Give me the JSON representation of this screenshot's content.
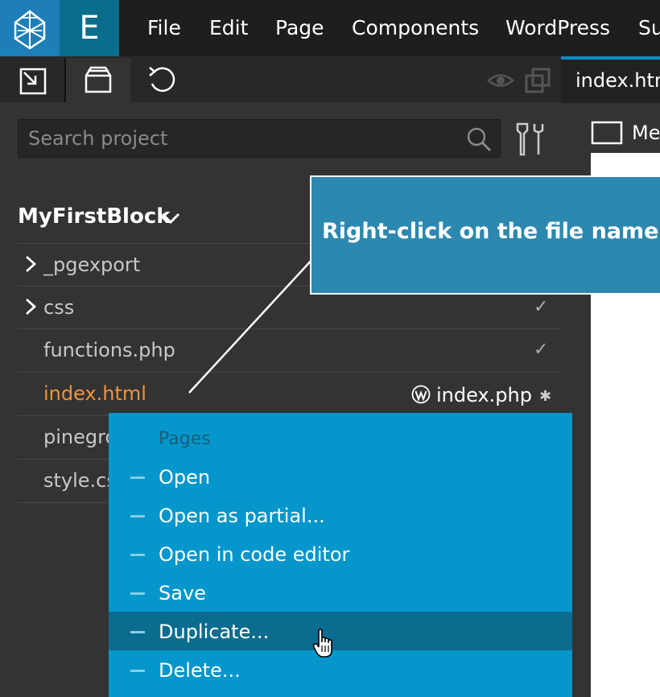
{
  "menubar": {
    "items": [
      "File",
      "Edit",
      "Page",
      "Components",
      "WordPress",
      "Su"
    ],
    "editor_letter": "E"
  },
  "search": {
    "placeholder": "Search project"
  },
  "project": {
    "name": "MyFirstBlock"
  },
  "files": [
    {
      "name": "_pgexport",
      "folder": true,
      "checked": false
    },
    {
      "name": "css",
      "folder": true,
      "checked": true
    },
    {
      "name": "functions.php",
      "folder": false,
      "checked": true
    },
    {
      "name": "index.html",
      "folder": false,
      "selected": true,
      "mapped": "index.php",
      "modified_mark": "✱"
    },
    {
      "name": "pinegro",
      "folder": false
    },
    {
      "name": "style.cs",
      "folder": false
    }
  ],
  "check_mark": "✓",
  "tab": {
    "label": "index.htm"
  },
  "right_panel": {
    "label": "Me"
  },
  "tooltip": {
    "text": "Right-click on the file name"
  },
  "context_menu": {
    "header": "Pages",
    "items": [
      "Open",
      "Open as partial...",
      "Open in code editor",
      "Save",
      "Duplicate...",
      "Delete..."
    ],
    "highlighted_index": 4
  },
  "colors": {
    "accent": "#0596cb",
    "selected_file": "#f0933b",
    "tooltip_bg": "#2d88af",
    "highlight": "#0a6d8f"
  }
}
